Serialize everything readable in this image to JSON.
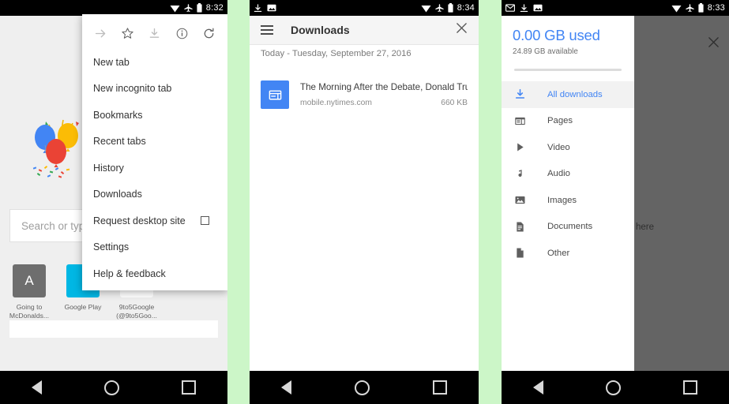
{
  "device_frames": [
    {
      "status_bar": {
        "notifications": [],
        "icons": [
          "wifi-icon",
          "airplane-icon",
          "battery-icon"
        ],
        "time": "8:32"
      }
    },
    {
      "status_bar": {
        "notifications": [
          "download-icon",
          "image-icon"
        ],
        "icons": [
          "wifi-icon",
          "airplane-icon",
          "battery-icon"
        ],
        "time": "8:34"
      }
    },
    {
      "status_bar": {
        "notifications": [
          "email-icon",
          "download-icon",
          "image-icon"
        ],
        "icons": [
          "wifi-icon",
          "airplane-icon",
          "battery-icon"
        ],
        "time": "8:33"
      }
    }
  ],
  "panel1": {
    "newtab": {
      "doodle_name": "google-birthday-balloons-doodle",
      "omnibox_placeholder": "Search or type URL",
      "tiles": [
        {
          "letter": "A",
          "label": "Going to McDonalds...",
          "color": "#6e6e6e"
        },
        {
          "letter": "",
          "label": "Google Play",
          "color": "#00b7e4"
        },
        {
          "letter": "",
          "label": "9to5Google (@9to5Goo...",
          "color": "#ffffff"
        }
      ]
    },
    "menu": {
      "top_icons": [
        "forward-arrow-icon",
        "bookmark-star-icon",
        "download-icon",
        "page-info-icon",
        "reload-icon"
      ],
      "items": [
        {
          "label": "New tab",
          "checkbox": false
        },
        {
          "label": "New incognito tab",
          "checkbox": false
        },
        {
          "label": "Bookmarks",
          "checkbox": false
        },
        {
          "label": "Recent tabs",
          "checkbox": false
        },
        {
          "label": "History",
          "checkbox": false
        },
        {
          "label": "Downloads",
          "checkbox": false
        },
        {
          "label": "Request desktop site",
          "checkbox": true
        },
        {
          "label": "Settings",
          "checkbox": false
        },
        {
          "label": "Help & feedback",
          "checkbox": false
        }
      ]
    }
  },
  "panel2": {
    "appbar": {
      "title": "Downloads",
      "menu_icon": "hamburger-icon",
      "close_icon": "close-icon"
    },
    "date_header": "Today - Tuesday, September 27, 2016",
    "items": [
      {
        "name": "The Morning After the Debate, Donald Tru…",
        "host": "mobile.nytimes.com",
        "size": "660 KB",
        "thumb_icon": "offline-page-icon",
        "thumb_color": "#4285f4"
      }
    ]
  },
  "panel3": {
    "drawer": {
      "storage_used": "0.00 GB used",
      "storage_available": "24.89 GB available",
      "accent_color": "#4285f4",
      "items": [
        {
          "label": "All downloads",
          "icon": "download-icon",
          "active": true
        },
        {
          "label": "Pages",
          "icon": "page-icon",
          "active": false
        },
        {
          "label": "Video",
          "icon": "video-play-icon",
          "active": false
        },
        {
          "label": "Audio",
          "icon": "audio-note-icon",
          "active": false
        },
        {
          "label": "Images",
          "icon": "image-icon",
          "active": false
        },
        {
          "label": "Documents",
          "icon": "document-icon",
          "active": false
        },
        {
          "label": "Other",
          "icon": "file-icon",
          "active": false
        }
      ]
    },
    "scrim": {
      "close_icon": "close-icon",
      "partial_text": "here"
    }
  },
  "navbar": {
    "back": "back-triangle-icon",
    "home": "home-circle-icon",
    "recents": "recents-square-icon"
  }
}
